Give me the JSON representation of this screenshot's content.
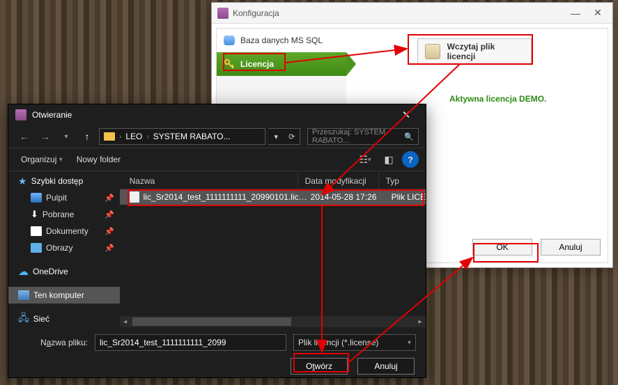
{
  "config_window": {
    "title": "Konfiguracja",
    "sidebar": {
      "db_label": "Baza danych MS SQL",
      "license_label": "Licencja"
    },
    "load_license_btn": "Wczytaj plik licencji",
    "license_status": "Aktywna licencja DEMO.",
    "ok_label": "OK",
    "cancel_label": "Anuluj"
  },
  "file_open": {
    "title": "Otwieranie",
    "path": {
      "seg1": "LEO",
      "seg2": "SYSTEM RABATO..."
    },
    "search_placeholder": "Przeszukaj: SYSTEM RABATO...",
    "toolbar": {
      "organize": "Organizuj",
      "new_folder": "Nowy folder"
    },
    "tree": {
      "quick": "Szybki dostęp",
      "desktop": "Pulpit",
      "downloads": "Pobrane",
      "documents": "Dokumenty",
      "pictures": "Obrazy",
      "onedrive": "OneDrive",
      "this_pc": "Ten komputer",
      "network": "Sieć"
    },
    "columns": {
      "name": "Nazwa",
      "date": "Data modyfikacji",
      "type": "Typ"
    },
    "file_row": {
      "name": "lic_Sr2014_test_1111111111_20990101.lice...",
      "date": "2014-05-28 17:26",
      "type": "Plik LICE"
    },
    "filename_label_pre": "N",
    "filename_label_u": "a",
    "filename_label_post": "zwa pliku:",
    "filename_value": "lic_Sr2014_test_1111111111_2099",
    "filetype_value": "Plik licencji (*.license)",
    "open_pre": "O",
    "open_u": "t",
    "open_post": "wórz",
    "cancel": "Anuluj"
  }
}
